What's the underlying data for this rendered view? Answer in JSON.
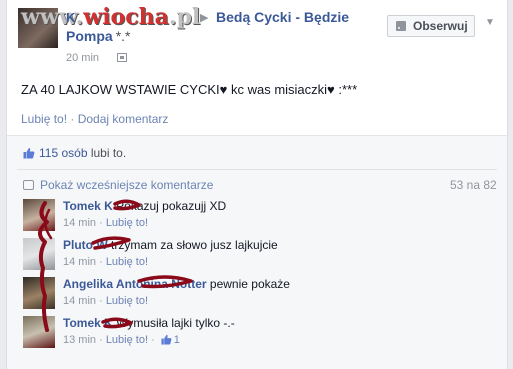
{
  "watermark": {
    "prefix": "www.",
    "brand": "wiocha",
    "suffix": ".pl"
  },
  "post": {
    "author": "K",
    "arrow": "▶",
    "group_line1": "Bedą Cycki - Będzie",
    "group_line2": "Pompa",
    "group_suffix": "*.*",
    "time": "20 min",
    "follow_label": "Obserwuj",
    "text": "ZA 40 LAJKOW WSTAWIE CYCKI♥ kc was misiaczki♥ :***",
    "like_action": "Lubię to!",
    "separator": " · ",
    "comment_action": "Dodaj komentarz"
  },
  "likes": {
    "count": "115 osób",
    "suffix": " lubi to."
  },
  "comments_header": {
    "previous": "Pokaż wcześniejsze komentarze",
    "page": "53 na 82"
  },
  "comments": [
    {
      "author": "Tomek K",
      "text": "Pokazuj pokazujj XD",
      "time": "14 min",
      "like": "Lubię to!",
      "likes": ""
    },
    {
      "author": "Pluto W",
      "text": "trzymam za słowo jusz lajkujcie",
      "time": "14 min",
      "like": "Lubię to!",
      "likes": ""
    },
    {
      "author": "Angelika Antonina Notter",
      "text": "pewnie pokaże",
      "time": "14 min",
      "like": "Lubię to!",
      "likes": ""
    },
    {
      "author": "Tomek K",
      "text": "Wymusiła lajki tylko -.-",
      "time": "13 min",
      "like": "Lubię to!",
      "likes": "1"
    }
  ],
  "colors": {
    "link": "#3b5998",
    "muted": "#90949c",
    "scribble": "#8b0a1a"
  }
}
